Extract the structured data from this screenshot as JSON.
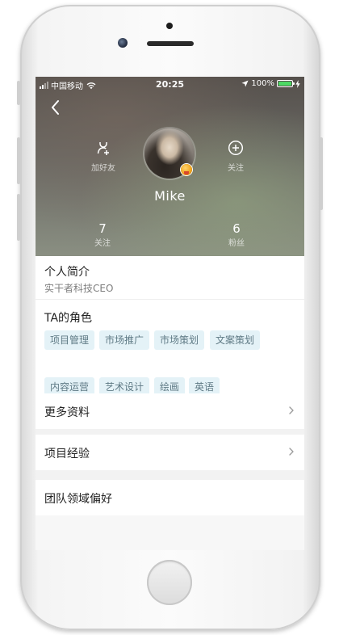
{
  "status_bar": {
    "carrier": "中国移动",
    "time": "20:25",
    "battery_percent": "100%",
    "battery_level": 1.0,
    "battery_color": "#4cd964"
  },
  "header": {
    "back_icon": "chevron-left-icon",
    "add_friend_label": "加好友",
    "add_friend_icon": "add-friend-icon",
    "follow_label": "关注",
    "follow_icon": "plus-circle-icon",
    "user_name": "Mike",
    "stats": [
      {
        "value": "7",
        "label": "关注"
      },
      {
        "value": "6",
        "label": "粉丝"
      }
    ]
  },
  "intro": {
    "title": "个人简介",
    "text": "实干者科技CEO"
  },
  "roles": {
    "title": "TA的角色",
    "tags": [
      "项目管理",
      "市场推广",
      "市场策划",
      "文案策划",
      "内容运营",
      "艺术设计",
      "绘画",
      "英语"
    ],
    "tag_bg": "#e4f2f7",
    "tag_text_color": "#5f7a85"
  },
  "rows": {
    "more_info": "更多资料",
    "project_experience": "项目经验",
    "team_preference": "团队领域偏好"
  }
}
